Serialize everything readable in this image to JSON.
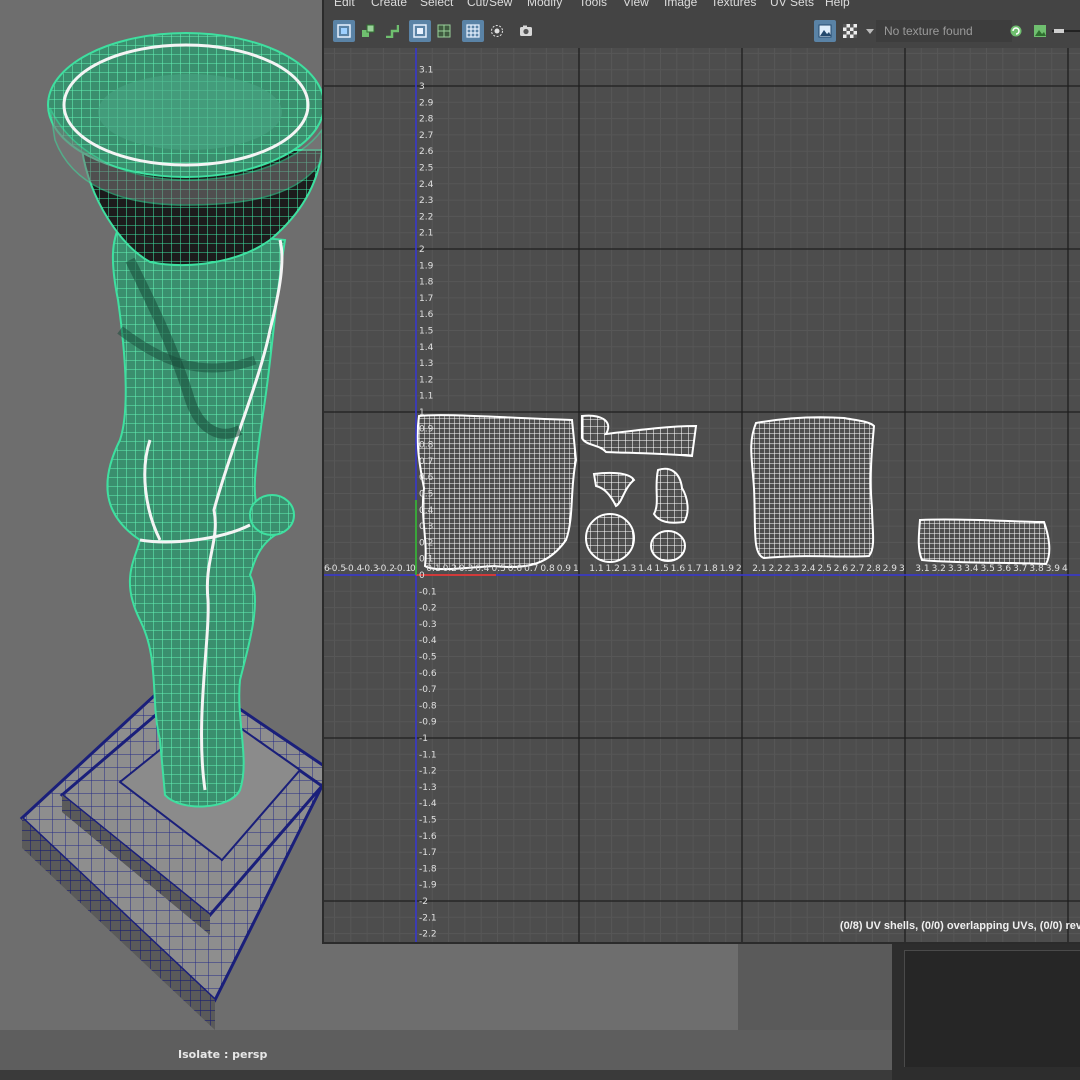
{
  "menu": [
    "Edit",
    "Create",
    "Select",
    "Cut/Sew",
    "Modify",
    "Tools",
    "View",
    "Image",
    "Textures",
    "UV Sets",
    "Help"
  ],
  "toolbar": {
    "texture_field": "No texture found",
    "icons": [
      "uv-shell-icon",
      "uv-component-icon",
      "uv-stack-icon",
      "frame-selection-icon",
      "frame-all-icon",
      "grid-toggle-icon",
      "pivot-icon",
      "snapshot-icon",
      "image-display-icon",
      "checker-icon",
      "dropdown-arrow-icon",
      "refresh-icon",
      "image-icon"
    ]
  },
  "uv_grid": {
    "v_labels": [
      "3.1",
      "3",
      "2.9",
      "2.8",
      "2.7",
      "2.6",
      "2.5",
      "2.4",
      "2.3",
      "2.2",
      "2.1",
      "2",
      "1.9",
      "1.8",
      "1.7",
      "1.6",
      "1.5",
      "1.4",
      "1.3",
      "1.2",
      "1.1",
      "1",
      "0.9",
      "0.8",
      "0.7",
      "0.6",
      "0.5",
      "0.4",
      "0.3",
      "0.2",
      "0.1",
      "0",
      "-0.1",
      "-0.2",
      "-0.3",
      "-0.4",
      "-0.5",
      "-0.6",
      "-0.7",
      "-0.8",
      "-0.9",
      "-1",
      "-1.1",
      "-1.2",
      "-1.3",
      "-1.4",
      "-1.5",
      "-1.6",
      "-1.7",
      "-1.8",
      "-1.9",
      "-2",
      "-2.1",
      "-2.2"
    ],
    "u_labels": [
      "-0.6",
      "-0.5",
      "-0.4",
      "-0.3",
      "-0.2",
      "-0.1",
      "0",
      "0.1",
      "0.2",
      "0.3",
      "0.4",
      "0.5",
      "0.6",
      "0.7",
      "0.8",
      "0.9",
      "1",
      "1.1",
      "1.2",
      "1.3",
      "1.4",
      "1.5",
      "1.6",
      "1.7",
      "1.8",
      "1.9",
      "2",
      "2.1",
      "2.2",
      "2.3",
      "2.4",
      "2.5",
      "2.6",
      "2.7",
      "2.8",
      "2.9",
      "3",
      "3.1",
      "3.2",
      "3.3",
      "3.4",
      "3.5",
      "3.6",
      "3.7",
      "3.8",
      "3.9",
      "4"
    ]
  },
  "status": "(0/8) UV shells, (0/0) overlapping UVs, (0/0) rev",
  "viewport": {
    "isolate_label": "Isolate : persp"
  },
  "colors": {
    "mesh_green": "#3ee0a0",
    "mesh_blue": "#1a1f7a",
    "uv_axis_blue": "#3b3bd9",
    "uv_axis_red": "#d23a3a",
    "uv_axis_green": "#3aa53a"
  }
}
